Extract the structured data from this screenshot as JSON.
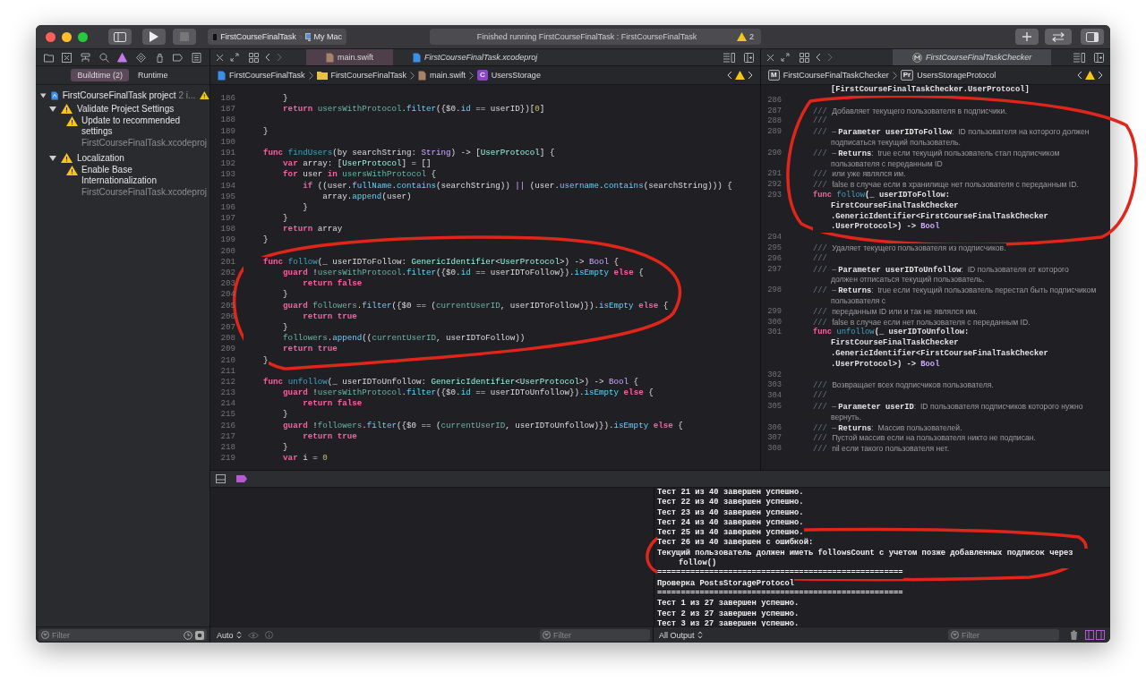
{
  "toolbar": {
    "scheme": "FirstCourseFinalTask",
    "destination": "My Mac",
    "activity": "Finished running FirstCourseFinalTask : FirstCourseFinalTask",
    "warning_count": "2"
  },
  "navigator": {
    "tabs": [
      {
        "selected": false
      },
      {
        "selected": false
      },
      {
        "selected": false
      },
      {
        "selected": false
      },
      {
        "selected": true
      },
      {
        "selected": false
      },
      {
        "selected": false
      },
      {
        "selected": false
      },
      {
        "selected": false
      }
    ],
    "segments": [
      {
        "label": "Buildtime (2)",
        "selected": true
      },
      {
        "label": "Runtime",
        "selected": false
      }
    ],
    "tree": [
      {
        "label": "FirstCourseFinalTask project",
        "detail": "2 i...",
        "expanded": true,
        "children": [
          {
            "label": "Validate Project Settings",
            "expanded": true,
            "children": [
              {
                "label": "Update to recommended settings",
                "path": "FirstCourseFinalTask.xcodeproj"
              }
            ]
          },
          {
            "label": "Localization",
            "expanded": true,
            "children": [
              {
                "label": "Enable Base Internationalization",
                "path": "FirstCourseFinalTask.xcodeproj"
              }
            ]
          }
        ]
      }
    ],
    "filter_placeholder": "Filter"
  },
  "left_editor": {
    "tabs": [
      {
        "label": "main.swift",
        "kind": "file",
        "selected": true
      },
      {
        "label": "FirstCourseFinalTask.xcodeproj",
        "kind": "project",
        "selected": false
      }
    ],
    "jump_bar": [
      {
        "kind": "project",
        "label": "FirstCourseFinalTask"
      },
      {
        "kind": "folder",
        "label": "FirstCourseFinalTask"
      },
      {
        "kind": "file",
        "label": "main.swift"
      },
      {
        "kind": "badge",
        "badge": "C",
        "label": "UsersStorage"
      }
    ],
    "lines": [
      {
        "num": "186",
        "tokens": [
          {
            "kind": "plain",
            "text": "        }"
          }
        ]
      },
      {
        "num": "187",
        "tokens": [
          {
            "kind": "keyword",
            "text": "        return "
          },
          {
            "kind": "ident",
            "text": "usersWithProtocol"
          },
          {
            "kind": "plain",
            "text": "."
          },
          {
            "kind": "member",
            "text": "filter"
          },
          {
            "kind": "plain",
            "text": "({$0."
          },
          {
            "kind": "member",
            "text": "id"
          },
          {
            "kind": "plain",
            "text": " == userID})["
          },
          {
            "kind": "number",
            "text": "0"
          },
          {
            "kind": "plain",
            "text": "]"
          }
        ]
      },
      {
        "num": "188"
      },
      {
        "num": "189",
        "tokens": [
          {
            "kind": "plain",
            "text": "    }"
          }
        ]
      },
      {
        "num": "190"
      },
      {
        "num": "191",
        "tokens": [
          {
            "kind": "keyword",
            "text": "    func "
          },
          {
            "kind": "func",
            "text": "findUsers"
          },
          {
            "kind": "plain",
            "text": "(by searchString: "
          },
          {
            "kind": "builtin",
            "text": "String"
          },
          {
            "kind": "plain",
            "text": ") -> ["
          },
          {
            "kind": "type",
            "text": "UserProtocol"
          },
          {
            "kind": "plain",
            "text": "] {"
          }
        ]
      },
      {
        "num": "192",
        "tokens": [
          {
            "kind": "keyword",
            "text": "        var "
          },
          {
            "kind": "plain",
            "text": "array: ["
          },
          {
            "kind": "type",
            "text": "UserProtocol"
          },
          {
            "kind": "plain",
            "text": "] = []"
          }
        ]
      },
      {
        "num": "193",
        "tokens": [
          {
            "kind": "keyword",
            "text": "        for "
          },
          {
            "kind": "plain",
            "text": "user "
          },
          {
            "kind": "keyword",
            "text": "in "
          },
          {
            "kind": "ident",
            "text": "usersWithProtocol"
          },
          {
            "kind": "plain",
            "text": " {"
          }
        ]
      },
      {
        "num": "194",
        "tokens": [
          {
            "kind": "keyword",
            "text": "            if "
          },
          {
            "kind": "plain",
            "text": "((user."
          },
          {
            "kind": "member",
            "text": "fullName"
          },
          {
            "kind": "plain",
            "text": "."
          },
          {
            "kind": "member",
            "text": "contains"
          },
          {
            "kind": "plain",
            "text": "(searchString)) "
          },
          {
            "kind": "builtin",
            "text": "||"
          },
          {
            "kind": "plain",
            "text": " (user."
          },
          {
            "kind": "member",
            "text": "username"
          },
          {
            "kind": "plain",
            "text": "."
          },
          {
            "kind": "member",
            "text": "contains"
          },
          {
            "kind": "plain",
            "text": "(searchString))) {"
          }
        ]
      },
      {
        "num": "195",
        "tokens": [
          {
            "kind": "plain",
            "text": "                array."
          },
          {
            "kind": "member",
            "text": "append"
          },
          {
            "kind": "plain",
            "text": "(user)"
          }
        ]
      },
      {
        "num": "196",
        "tokens": [
          {
            "kind": "plain",
            "text": "            }"
          }
        ]
      },
      {
        "num": "197",
        "tokens": [
          {
            "kind": "plain",
            "text": "        }"
          }
        ]
      },
      {
        "num": "198",
        "tokens": [
          {
            "kind": "keyword",
            "text": "        return "
          },
          {
            "kind": "plain",
            "text": "array"
          }
        ]
      },
      {
        "num": "199",
        "tokens": [
          {
            "kind": "plain",
            "text": "    }"
          }
        ]
      },
      {
        "num": "200"
      },
      {
        "num": "201",
        "tokens": [
          {
            "kind": "keyword",
            "text": "    func "
          },
          {
            "kind": "func",
            "text": "follow"
          },
          {
            "kind": "plain",
            "text": "(_ userIDToFollow: "
          },
          {
            "kind": "type",
            "text": "GenericIdentifier"
          },
          {
            "kind": "plain",
            "text": "<"
          },
          {
            "kind": "type",
            "text": "UserProtocol"
          },
          {
            "kind": "plain",
            "text": ">) -> "
          },
          {
            "kind": "builtin",
            "text": "Bool"
          },
          {
            "kind": "plain",
            "text": " {"
          }
        ]
      },
      {
        "num": "202",
        "tokens": [
          {
            "kind": "keyword",
            "text": "        guard "
          },
          {
            "kind": "plain",
            "text": "!"
          },
          {
            "kind": "ident",
            "text": "usersWithProtocol"
          },
          {
            "kind": "plain",
            "text": "."
          },
          {
            "kind": "member",
            "text": "filter"
          },
          {
            "kind": "plain",
            "text": "({$0."
          },
          {
            "kind": "member",
            "text": "id"
          },
          {
            "kind": "plain",
            "text": " == userIDToFollow})."
          },
          {
            "kind": "member",
            "text": "isEmpty"
          },
          {
            "kind": "keyword",
            "text": " else"
          },
          {
            "kind": "plain",
            "text": " {"
          }
        ]
      },
      {
        "num": "203",
        "tokens": [
          {
            "kind": "keyword",
            "text": "            return false"
          }
        ]
      },
      {
        "num": "204",
        "tokens": [
          {
            "kind": "plain",
            "text": "        }"
          }
        ]
      },
      {
        "num": "205",
        "tokens": [
          {
            "kind": "keyword",
            "text": "        guard "
          },
          {
            "kind": "ident",
            "text": "followers"
          },
          {
            "kind": "plain",
            "text": "."
          },
          {
            "kind": "member",
            "text": "filter"
          },
          {
            "kind": "plain",
            "text": "({$0 == ("
          },
          {
            "kind": "ident",
            "text": "currentUserID"
          },
          {
            "kind": "plain",
            "text": ", userIDToFollow)})."
          },
          {
            "kind": "member",
            "text": "isEmpty"
          },
          {
            "kind": "keyword",
            "text": " else"
          },
          {
            "kind": "plain",
            "text": " {"
          }
        ]
      },
      {
        "num": "206",
        "tokens": [
          {
            "kind": "keyword",
            "text": "            return true"
          }
        ]
      },
      {
        "num": "207",
        "tokens": [
          {
            "kind": "plain",
            "text": "        }"
          }
        ]
      },
      {
        "num": "208",
        "tokens": [
          {
            "kind": "ident",
            "text": "        followers"
          },
          {
            "kind": "plain",
            "text": "."
          },
          {
            "kind": "member",
            "text": "append"
          },
          {
            "kind": "plain",
            "text": "(("
          },
          {
            "kind": "ident",
            "text": "currentUserID"
          },
          {
            "kind": "plain",
            "text": ", userIDToFollow))"
          }
        ]
      },
      {
        "num": "209",
        "tokens": [
          {
            "kind": "keyword",
            "text": "        return true"
          }
        ]
      },
      {
        "num": "210",
        "tokens": [
          {
            "kind": "plain",
            "text": "    }"
          }
        ]
      },
      {
        "num": "211"
      },
      {
        "num": "212",
        "tokens": [
          {
            "kind": "keyword",
            "text": "    func "
          },
          {
            "kind": "func",
            "text": "unfollow"
          },
          {
            "kind": "plain",
            "text": "(_ userIDToUnfollow: "
          },
          {
            "kind": "type",
            "text": "GenericIdentifier"
          },
          {
            "kind": "plain",
            "text": "<"
          },
          {
            "kind": "type",
            "text": "UserProtocol"
          },
          {
            "kind": "plain",
            "text": ">) -> "
          },
          {
            "kind": "builtin",
            "text": "Bool"
          },
          {
            "kind": "plain",
            "text": " {"
          }
        ]
      },
      {
        "num": "213",
        "tokens": [
          {
            "kind": "keyword",
            "text": "        guard "
          },
          {
            "kind": "plain",
            "text": "!"
          },
          {
            "kind": "ident",
            "text": "usersWithProtocol"
          },
          {
            "kind": "plain",
            "text": "."
          },
          {
            "kind": "member",
            "text": "filter"
          },
          {
            "kind": "plain",
            "text": "({$0."
          },
          {
            "kind": "member",
            "text": "id"
          },
          {
            "kind": "plain",
            "text": " == userIDToUnfollow})."
          },
          {
            "kind": "member",
            "text": "isEmpty"
          },
          {
            "kind": "keyword",
            "text": " else"
          },
          {
            "kind": "plain",
            "text": " {"
          }
        ]
      },
      {
        "num": "214",
        "tokens": [
          {
            "kind": "keyword",
            "text": "            return false"
          }
        ]
      },
      {
        "num": "215",
        "tokens": [
          {
            "kind": "plain",
            "text": "        }"
          }
        ]
      },
      {
        "num": "216",
        "tokens": [
          {
            "kind": "keyword",
            "text": "        guard "
          },
          {
            "kind": "plain",
            "text": "!"
          },
          {
            "kind": "ident",
            "text": "followers"
          },
          {
            "kind": "plain",
            "text": "."
          },
          {
            "kind": "member",
            "text": "filter"
          },
          {
            "kind": "plain",
            "text": "({$0 == ("
          },
          {
            "kind": "ident",
            "text": "currentUserID"
          },
          {
            "kind": "plain",
            "text": ", userIDToUnfollow)})."
          },
          {
            "kind": "member",
            "text": "isEmpty"
          },
          {
            "kind": "keyword",
            "text": " else"
          },
          {
            "kind": "plain",
            "text": " {"
          }
        ]
      },
      {
        "num": "217",
        "tokens": [
          {
            "kind": "keyword",
            "text": "            return true"
          }
        ]
      },
      {
        "num": "218",
        "tokens": [
          {
            "kind": "plain",
            "text": "        }"
          }
        ]
      },
      {
        "num": "219",
        "tokens": [
          {
            "kind": "keyword",
            "text": "        var "
          },
          {
            "kind": "plain",
            "text": "i = "
          },
          {
            "kind": "number",
            "text": "0"
          }
        ]
      }
    ]
  },
  "right_editor": {
    "tabs": [
      {
        "label": "FirstCourseFinalTaskChecker",
        "kind": "module",
        "selected": true
      }
    ],
    "jump_bar": [
      {
        "kind": "badge",
        "badge": "M",
        "label": "FirstCourseFinalTaskChecker"
      },
      {
        "kind": "badge",
        "badge": "Pr",
        "label": "UsersStorageProtocol"
      }
    ],
    "lines": [
      {
        "wrapped": true,
        "tokens": [
          {
            "kind": "type",
            "text": "[FirstCourseFinalTaskChecker.UserProtocol]"
          }
        ]
      },
      {
        "num": "286"
      },
      {
        "num": "287",
        "tokens": [
          {
            "kind": "comment",
            "text": "/// "
          },
          {
            "kind": "doc",
            "text": "Добавляет текущего пользователя в подписчики."
          }
        ]
      },
      {
        "num": "288",
        "tokens": [
          {
            "kind": "comment",
            "text": "///"
          }
        ]
      },
      {
        "num": "289",
        "tokens": [
          {
            "kind": "comment",
            "text": "/// "
          },
          {
            "kind": "doc",
            "text": "– "
          },
          {
            "kind": "param",
            "text": "Parameter userIDToFollow"
          },
          {
            "kind": "doc",
            "text": ":  ID пользователя на которого должен"
          }
        ]
      },
      {
        "wrapped": true,
        "tokens": [
          {
            "kind": "doc",
            "text": "подписаться текущий пользователь."
          }
        ]
      },
      {
        "num": "290",
        "tokens": [
          {
            "kind": "comment",
            "text": "/// "
          },
          {
            "kind": "doc",
            "text": "– "
          },
          {
            "kind": "param",
            "text": "Returns"
          },
          {
            "kind": "doc",
            "text": ":  true если текущий пользователь стал подписчиком"
          }
        ]
      },
      {
        "wrapped": true,
        "tokens": [
          {
            "kind": "doc",
            "text": "пользователя с переданным ID"
          }
        ]
      },
      {
        "num": "291",
        "tokens": [
          {
            "kind": "comment",
            "text": "/// "
          },
          {
            "kind": "doc",
            "text": "или уже являлся им."
          }
        ]
      },
      {
        "num": "292",
        "tokens": [
          {
            "kind": "comment",
            "text": "/// "
          },
          {
            "kind": "doc",
            "text": "false в случае если в хранилище нет пользователя с переданным ID."
          }
        ]
      },
      {
        "num": "293",
        "tokens": [
          {
            "kind": "keyword",
            "text": "func "
          },
          {
            "kind": "func",
            "text": "follow"
          },
          {
            "kind": "plain",
            "text": "(_ userIDToFollow:"
          }
        ]
      },
      {
        "wrapped": true,
        "tokens": [
          {
            "kind": "plain",
            "text": "FirstCourseFinalTaskChecker"
          }
        ]
      },
      {
        "wrapped": true,
        "tokens": [
          {
            "kind": "plain",
            "text": ".GenericIdentifier<FirstCourseFinalTaskChecker"
          }
        ]
      },
      {
        "wrapped": true,
        "tokens": [
          {
            "kind": "plain",
            "text": ".UserProtocol>) -> "
          },
          {
            "kind": "builtin",
            "text": "Bool"
          }
        ]
      },
      {
        "num": "294"
      },
      {
        "num": "295",
        "tokens": [
          {
            "kind": "comment",
            "text": "/// "
          },
          {
            "kind": "doc",
            "text": "Удаляет текущего пользователя из подписчиков."
          }
        ]
      },
      {
        "num": "296",
        "tokens": [
          {
            "kind": "comment",
            "text": "///"
          }
        ]
      },
      {
        "num": "297",
        "tokens": [
          {
            "kind": "comment",
            "text": "/// "
          },
          {
            "kind": "doc",
            "text": "– "
          },
          {
            "kind": "param",
            "text": "Parameter userIDToUnfollow"
          },
          {
            "kind": "doc",
            "text": ":  ID пользователя от которого"
          }
        ]
      },
      {
        "wrapped": true,
        "tokens": [
          {
            "kind": "doc",
            "text": "должен отписаться текущий пользователь."
          }
        ]
      },
      {
        "num": "298",
        "tokens": [
          {
            "kind": "comment",
            "text": "/// "
          },
          {
            "kind": "doc",
            "text": "– "
          },
          {
            "kind": "param",
            "text": "Returns"
          },
          {
            "kind": "doc",
            "text": ":  true если текущий пользователь перестал быть подписчиком"
          }
        ]
      },
      {
        "wrapped": true,
        "tokens": [
          {
            "kind": "doc",
            "text": "пользователя с"
          }
        ]
      },
      {
        "num": "299",
        "tokens": [
          {
            "kind": "comment",
            "text": "/// "
          },
          {
            "kind": "doc",
            "text": "переданным ID или и так не являлся им."
          }
        ]
      },
      {
        "num": "300",
        "tokens": [
          {
            "kind": "comment",
            "text": "/// "
          },
          {
            "kind": "doc",
            "text": "false в случае если нет пользователя с переданным ID."
          }
        ]
      },
      {
        "num": "301",
        "tokens": [
          {
            "kind": "keyword",
            "text": "func "
          },
          {
            "kind": "func",
            "text": "unfollow"
          },
          {
            "kind": "plain",
            "text": "(_ userIDToUnfollow:"
          }
        ]
      },
      {
        "wrapped": true,
        "tokens": [
          {
            "kind": "plain",
            "text": "FirstCourseFinalTaskChecker"
          }
        ]
      },
      {
        "wrapped": true,
        "tokens": [
          {
            "kind": "plain",
            "text": ".GenericIdentifier<FirstCourseFinalTaskChecker"
          }
        ]
      },
      {
        "wrapped": true,
        "tokens": [
          {
            "kind": "plain",
            "text": ".UserProtocol>) -> "
          },
          {
            "kind": "builtin",
            "text": "Bool"
          }
        ]
      },
      {
        "num": "302"
      },
      {
        "num": "303",
        "tokens": [
          {
            "kind": "comment",
            "text": "/// "
          },
          {
            "kind": "doc",
            "text": "Возвращает всех подписчиков пользователя."
          }
        ]
      },
      {
        "num": "304",
        "tokens": [
          {
            "kind": "comment",
            "text": "///"
          }
        ]
      },
      {
        "num": "305",
        "tokens": [
          {
            "kind": "comment",
            "text": "/// "
          },
          {
            "kind": "doc",
            "text": "– "
          },
          {
            "kind": "param",
            "text": "Parameter userID"
          },
          {
            "kind": "doc",
            "text": ":  ID пользователя подписчиков которого нужно"
          }
        ]
      },
      {
        "wrapped": true,
        "tokens": [
          {
            "kind": "doc",
            "text": "вернуть."
          }
        ]
      },
      {
        "num": "306",
        "tokens": [
          {
            "kind": "comment",
            "text": "/// "
          },
          {
            "kind": "doc",
            "text": "– "
          },
          {
            "kind": "param",
            "text": "Returns"
          },
          {
            "kind": "doc",
            "text": ":  Массив пользователей."
          }
        ]
      },
      {
        "num": "307",
        "tokens": [
          {
            "kind": "comment",
            "text": "/// "
          },
          {
            "kind": "doc",
            "text": "Пустой массив если на пользователя никто не подписан."
          }
        ]
      },
      {
        "num": "308",
        "tokens": [
          {
            "kind": "comment",
            "text": "/// "
          },
          {
            "kind": "doc",
            "text": "nil если такого пользователя нет."
          }
        ]
      }
    ]
  },
  "variables": {
    "scope": "Auto",
    "filter_placeholder": "Filter"
  },
  "console": {
    "lines": [
      "Тест 21 из 40 завершен успешно.",
      "Тест 22 из 40 завершен успешно.",
      "Тест 23 из 40 завершен успешно.",
      "Тест 24 из 40 завершен успешно.",
      "Тест 25 из 40 завершен успешно.",
      "Тест 26 из 40 завершен с ошибкой:",
      "Текущий пользователь должен иметь followsCount с учетом позже добавленных подписок через follow()",
      "====================================================",
      "Проверка PostsStorageProtocol",
      "====================================================",
      "Тест 1 из 27 завершен успешно.",
      "Тест 2 из 27 завершен успешно.",
      "Тест 3 из 27 завершен успешно."
    ],
    "output": "All Output",
    "filter_placeholder": "Filter"
  }
}
